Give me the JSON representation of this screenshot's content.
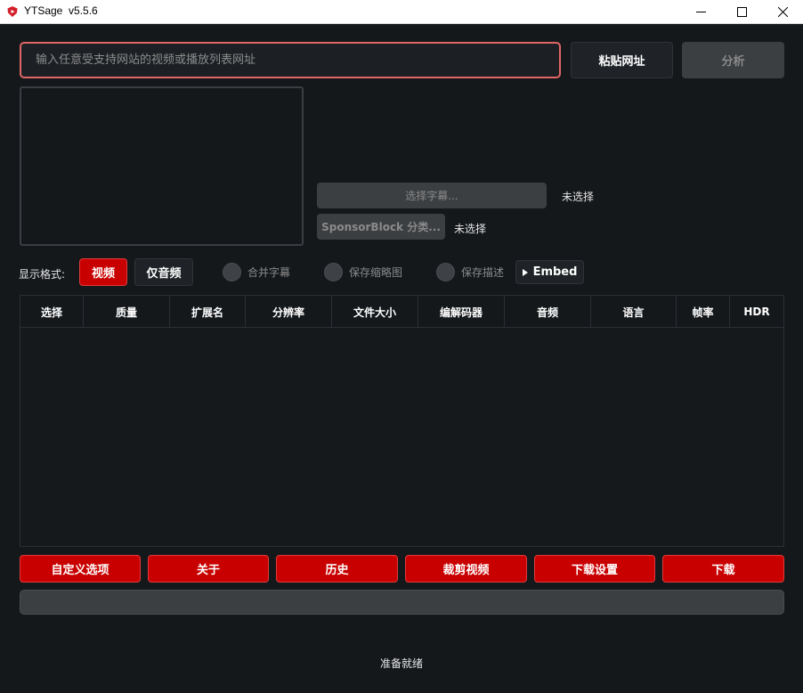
{
  "window": {
    "title": "YTSage  v5.5.6",
    "controls": [
      "minimize-icon",
      "maximize-icon",
      "close-icon"
    ]
  },
  "url_bar": {
    "placeholder": "输入任意受支持网站的视频或播放列表网址",
    "value": "",
    "paste_label": "粘贴网址",
    "analyze_label": "分析"
  },
  "subtitles": {
    "select_label": "选择字幕...",
    "status": "未选择"
  },
  "sponsorblock": {
    "select_label": "SponsorBlock 分类...",
    "status": "未选择"
  },
  "format": {
    "label": "显示格式:",
    "video_label": "视频",
    "audio_label": "仅音频",
    "selected": "视频"
  },
  "options": {
    "merge_subs": "合并字幕",
    "save_thumb": "保存缩略图",
    "save_desc": "保存描述",
    "embed_label": "Embed"
  },
  "table": {
    "columns": [
      "选择",
      "质量",
      "扩展名",
      "分辨率",
      "文件大小",
      "编解码器",
      "音频",
      "语言",
      "帧率",
      "HDR"
    ],
    "rows": []
  },
  "actions": {
    "custom": "自定义选项",
    "about": "关于",
    "history": "历史",
    "trim": "裁剪视频",
    "download_settings": "下载设置",
    "download": "下载"
  },
  "progress": {
    "value": 0
  },
  "status": "准备就绪",
  "colors": {
    "accent": "#c90000",
    "input_border": "#e06666",
    "background": "#15181b"
  }
}
